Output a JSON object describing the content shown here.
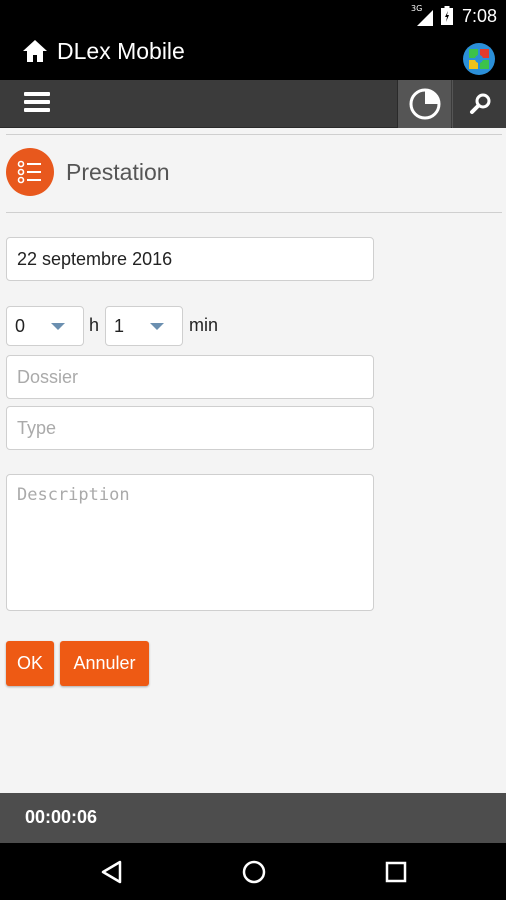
{
  "status_bar": {
    "network": "3G",
    "time": "7:08"
  },
  "app_bar": {
    "title": "DLex Mobile"
  },
  "toolbar": {
    "icons": [
      "menu-icon",
      "clock-icon",
      "search-icon"
    ]
  },
  "page": {
    "title": "Prestation"
  },
  "form": {
    "date": "22 septembre 2016",
    "hours": "0",
    "hours_unit": "h",
    "minutes": "1",
    "minutes_unit": "min",
    "dossier_placeholder": "Dossier",
    "type_placeholder": "Type",
    "description_placeholder": "Description",
    "ok_label": "OK",
    "cancel_label": "Annuler"
  },
  "timer": {
    "elapsed": "00:00:06"
  },
  "colors": {
    "accent": "#ee5a14",
    "toolbar": "#3b3b3b",
    "timer_bar": "#4d4d4d"
  }
}
